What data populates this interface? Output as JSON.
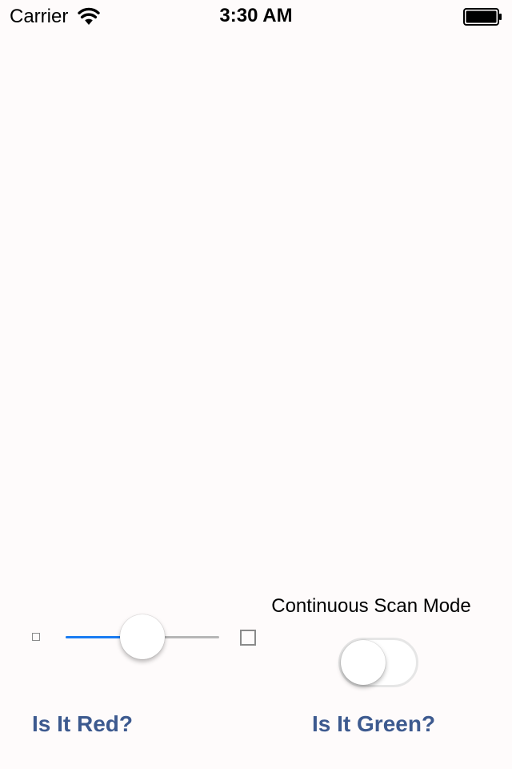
{
  "status_bar": {
    "carrier": "Carrier",
    "time": "3:30 AM",
    "wifi_icon": "wifi-icon",
    "battery_icon": "battery-icon"
  },
  "slider": {
    "value": 0.5,
    "min_icon": "small-square-icon",
    "max_icon": "large-square-icon",
    "fill_color": "#1a7cf2",
    "track_color": "#b7b7b7"
  },
  "toggle": {
    "label": "Continuous Scan Mode",
    "on": false
  },
  "buttons": {
    "red_label": "Is It Red?",
    "green_label": "Is It Green?",
    "color": "#3d5a8f"
  }
}
